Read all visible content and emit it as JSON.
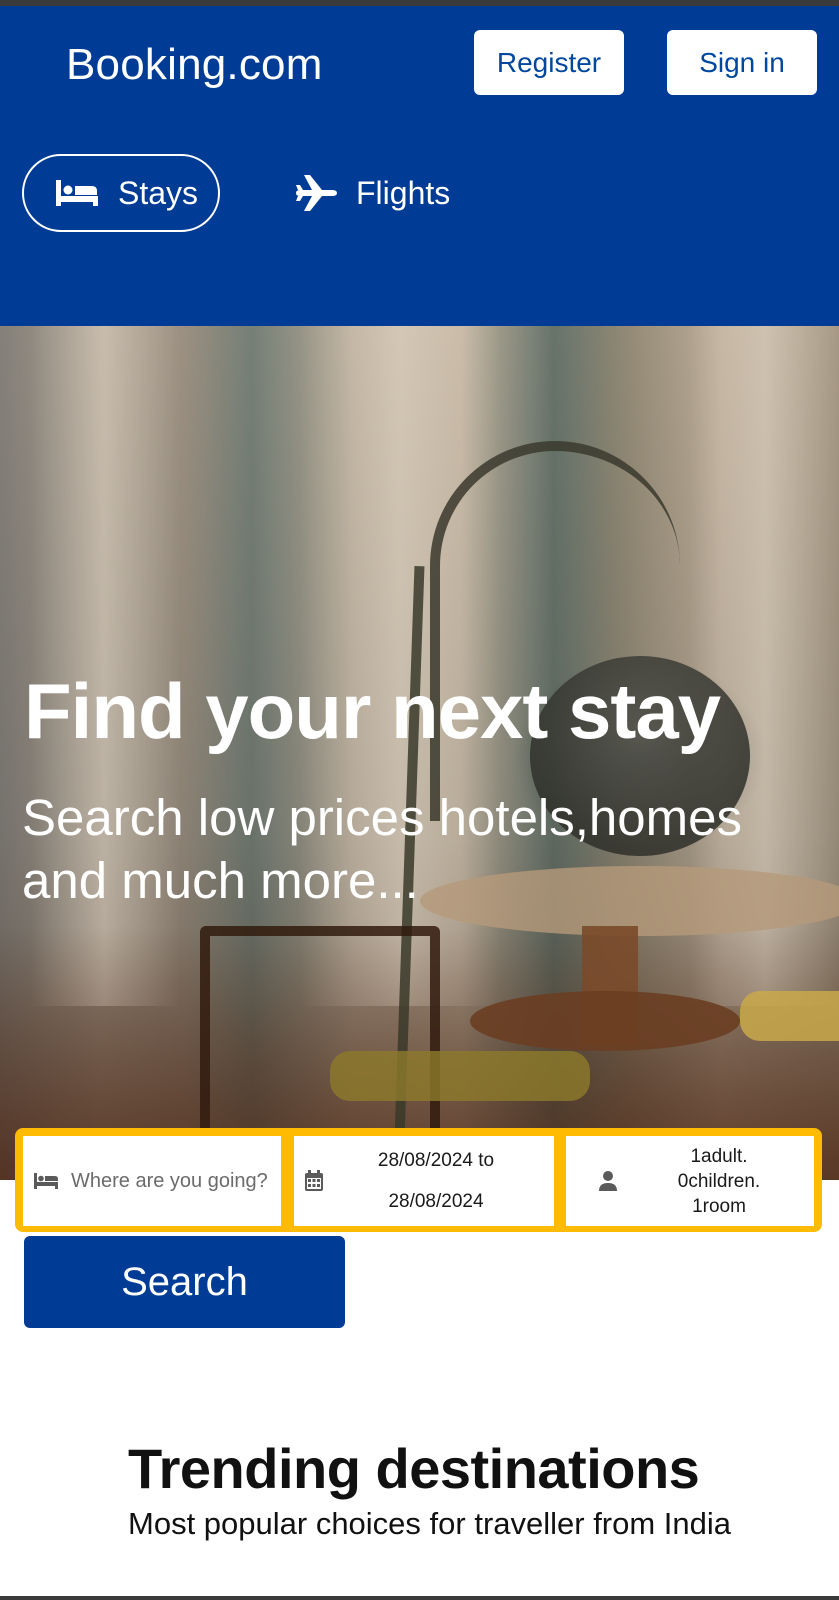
{
  "header": {
    "logo": "Booking.com",
    "register_label": "Register",
    "signin_label": "Sign in",
    "tabs": [
      {
        "label": "Stays",
        "icon": "bed-icon",
        "selected": true
      },
      {
        "label": "Flights",
        "icon": "airplane-icon",
        "selected": false
      }
    ]
  },
  "hero": {
    "title": "Find your next stay",
    "subtitle": "Search low prices hotels,homes and much more..."
  },
  "search": {
    "destination_placeholder": "Where are you going?",
    "date_from": "28/08/2024 to",
    "date_to": "28/08/2024",
    "guests_line1": "1adult.",
    "guests_line2": "0children.",
    "guests_line3": "1room",
    "button_label": "Search"
  },
  "trending": {
    "title": "Trending destinations",
    "subtitle": "Most popular choices for traveller from India"
  },
  "colors": {
    "brand_blue": "#003b95",
    "search_border": "#febb02",
    "white": "#ffffff"
  }
}
